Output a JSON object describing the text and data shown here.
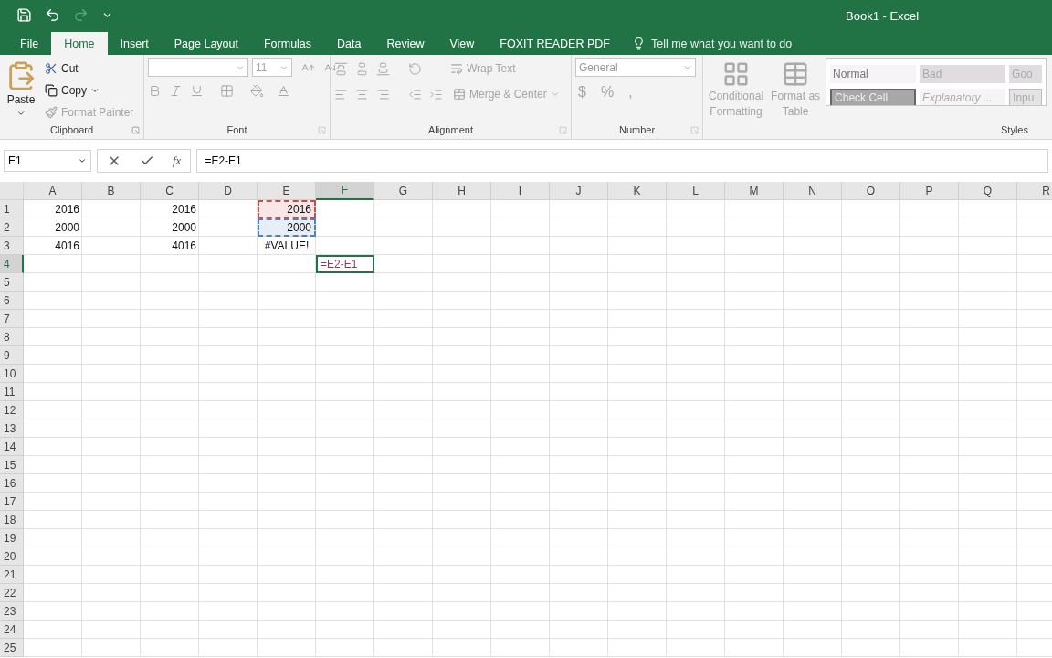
{
  "window": {
    "title": "Book1 - Excel"
  },
  "tabs": [
    {
      "label": "File",
      "selected": false
    },
    {
      "label": "Home",
      "selected": true
    },
    {
      "label": "Insert",
      "selected": false
    },
    {
      "label": "Page Layout",
      "selected": false
    },
    {
      "label": "Formulas",
      "selected": false
    },
    {
      "label": "Data",
      "selected": false
    },
    {
      "label": "Review",
      "selected": false
    },
    {
      "label": "View",
      "selected": false
    },
    {
      "label": "FOXIT READER PDF",
      "selected": false
    }
  ],
  "tell_me": {
    "placeholder": "Tell me what you want to do"
  },
  "clipboard": {
    "label": "Clipboard",
    "paste": "Paste",
    "cut": "Cut",
    "copy": "Copy",
    "format_painter": {
      "label": "Format Painter",
      "disabled": true
    }
  },
  "font": {
    "label": "Font",
    "size": "11",
    "disabled": true
  },
  "alignment": {
    "label": "Alignment",
    "wrap_text": "Wrap Text",
    "merge": "Merge & Center",
    "disabled": true
  },
  "number": {
    "label": "Number",
    "format": "General",
    "symbols": [
      "$",
      "%",
      ","
    ],
    "disabled": true
  },
  "styles": {
    "label": "Styles",
    "conditional": [
      "Conditional",
      "Formatting"
    ],
    "format_table": [
      "Format as",
      "Table"
    ],
    "gallery": [
      {
        "label": "Normal",
        "kind": "normal"
      },
      {
        "label": "Bad",
        "kind": "bad"
      },
      {
        "label": "Goo",
        "kind": "good"
      },
      {
        "label": "Check Cell",
        "kind": "check"
      },
      {
        "label": "Explanatory ...",
        "kind": "explanatory"
      },
      {
        "label": "Inpu",
        "kind": "input"
      }
    ]
  },
  "name_box": {
    "value": "E1"
  },
  "formula_bar": {
    "function_label": "fx",
    "value": "=E2-E1"
  },
  "columns": [
    {
      "label": "A",
      "selected": false
    },
    {
      "label": "B",
      "selected": false
    },
    {
      "label": "C",
      "selected": false
    },
    {
      "label": "D",
      "selected": false
    },
    {
      "label": "E",
      "selected": false
    },
    {
      "label": "F",
      "selected": true
    },
    {
      "label": "G",
      "selected": false
    },
    {
      "label": "H",
      "selected": false
    },
    {
      "label": "I",
      "selected": false
    },
    {
      "label": "J",
      "selected": false
    },
    {
      "label": "K",
      "selected": false
    },
    {
      "label": "L",
      "selected": false
    },
    {
      "label": "M",
      "selected": false
    },
    {
      "label": "N",
      "selected": false
    },
    {
      "label": "O",
      "selected": false
    },
    {
      "label": "P",
      "selected": false
    },
    {
      "label": "Q",
      "selected": false
    },
    {
      "label": "R",
      "selected": false
    }
  ],
  "rows": [
    {
      "header": "1",
      "selected": false,
      "cells": [
        {
          "value": "2016"
        },
        {},
        {
          "value": "2016"
        },
        {},
        {
          "value": "2016",
          "color": "#c0504d"
        }
      ]
    },
    {
      "header": "2",
      "selected": false,
      "cells": [
        {
          "value": "2000"
        },
        {},
        {
          "value": "2000"
        },
        {},
        {
          "value": "2000",
          "color": "#4f81bd"
        }
      ]
    },
    {
      "header": "3",
      "selected": false,
      "cells": [
        {
          "value": "4016"
        },
        {},
        {
          "value": "4016"
        },
        {},
        {
          "value": "#VALUE!",
          "kind": "error"
        }
      ]
    },
    {
      "header": "4",
      "selected": true,
      "cells": [
        {},
        {},
        {},
        {},
        {},
        {
          "value": "=E2-E1",
          "editing": true
        }
      ]
    },
    {
      "header": "5",
      "selected": false,
      "cells": []
    },
    {
      "header": "6",
      "selected": false,
      "cells": []
    },
    {
      "header": "7",
      "selected": false,
      "cells": []
    },
    {
      "header": "8",
      "selected": false,
      "cells": []
    },
    {
      "header": "9",
      "selected": false,
      "cells": []
    },
    {
      "header": "10",
      "selected": false,
      "cells": []
    },
    {
      "header": "11",
      "selected": false,
      "cells": []
    },
    {
      "header": "12",
      "selected": false,
      "cells": []
    },
    {
      "header": "13",
      "selected": false,
      "cells": []
    },
    {
      "header": "14",
      "selected": false,
      "cells": []
    },
    {
      "header": "15",
      "selected": false,
      "cells": []
    },
    {
      "header": "16",
      "selected": false,
      "cells": []
    },
    {
      "header": "17",
      "selected": false,
      "cells": []
    },
    {
      "header": "18",
      "selected": false,
      "cells": []
    },
    {
      "header": "19",
      "selected": false,
      "cells": []
    },
    {
      "header": "20",
      "selected": false,
      "cells": []
    },
    {
      "header": "21",
      "selected": false,
      "cells": []
    },
    {
      "header": "22",
      "selected": false,
      "cells": []
    },
    {
      "header": "23",
      "selected": false,
      "cells": []
    },
    {
      "header": "24",
      "selected": false,
      "cells": []
    },
    {
      "header": "25",
      "selected": false,
      "cells": []
    }
  ]
}
